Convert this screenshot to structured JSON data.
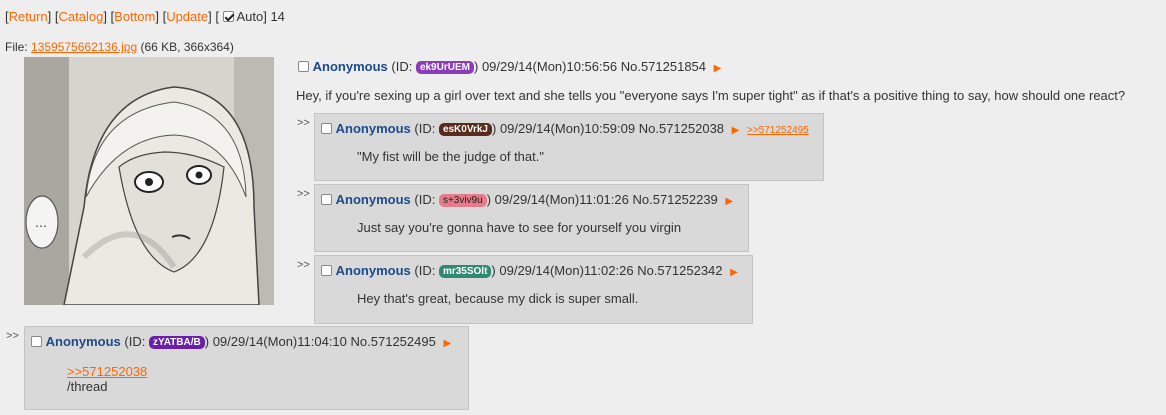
{
  "nav": {
    "return": "Return",
    "catalog": "Catalog",
    "bottom": "Bottom",
    "update": "Update",
    "auto": "Auto",
    "count": "14"
  },
  "file": {
    "prefix": "File: ",
    "name": "1359575662136.jpg",
    "meta": " (66 KB, 366x364)"
  },
  "op": {
    "name": "Anonymous",
    "id_prefix": "(ID: ",
    "id": "ek9UrUEM",
    "id_color": "#8b3cb8",
    "id_suffix": ")",
    "datetime": "09/29/14(Mon)10:56:56",
    "no": "No.571251854",
    "text": "Hey, if you're sexing up a girl over text and she tells you \"everyone says I'm super tight\" as if that's a positive thing to say, how should one react?"
  },
  "replies": [
    {
      "marker": ">>",
      "name": "Anonymous",
      "id_prefix": "(ID: ",
      "id": "esK0VrkJ",
      "id_color": "#5a2a1a",
      "id_suffix": ")",
      "datetime": "09/29/14(Mon)10:59:09",
      "no": "No.571252038",
      "backlink": ">>571252495",
      "text": "\"My fist will be the judge of that.\""
    },
    {
      "marker": ">>",
      "name": "Anonymous",
      "id_prefix": "(ID: ",
      "id": "s+3viv9u",
      "id_color": "#e87b8a",
      "id_suffix": ")",
      "datetime": "09/29/14(Mon)11:01:26",
      "no": "No.571252239",
      "text": "Just say you're gonna have to see for yourself you virgin"
    },
    {
      "marker": ">>",
      "name": "Anonymous",
      "id_prefix": "(ID: ",
      "id": "mr35SOlt",
      "id_color": "#2f8a74",
      "id_suffix": ")",
      "datetime": "09/29/14(Mon)11:02:26",
      "no": "No.571252342",
      "text": "Hey that's great, because my dick is super small."
    },
    {
      "marker": ">>",
      "name": "Anonymous",
      "id_prefix": "(ID: ",
      "id": "zYATBA/B",
      "id_color": "#6a1fa8",
      "id_suffix": ")",
      "datetime": "09/29/14(Mon)11:04:10",
      "no": "No.571252495",
      "quote": ">>571252038",
      "text": "/thread"
    }
  ],
  "icons": {
    "arrow": "right-triangle",
    "checkbox": "checkbox"
  },
  "colors": {
    "link": "#ff6600",
    "name": "#1b4a8c",
    "reply_bg": "#d9d9d9",
    "page_bg": "#eeeeee"
  }
}
